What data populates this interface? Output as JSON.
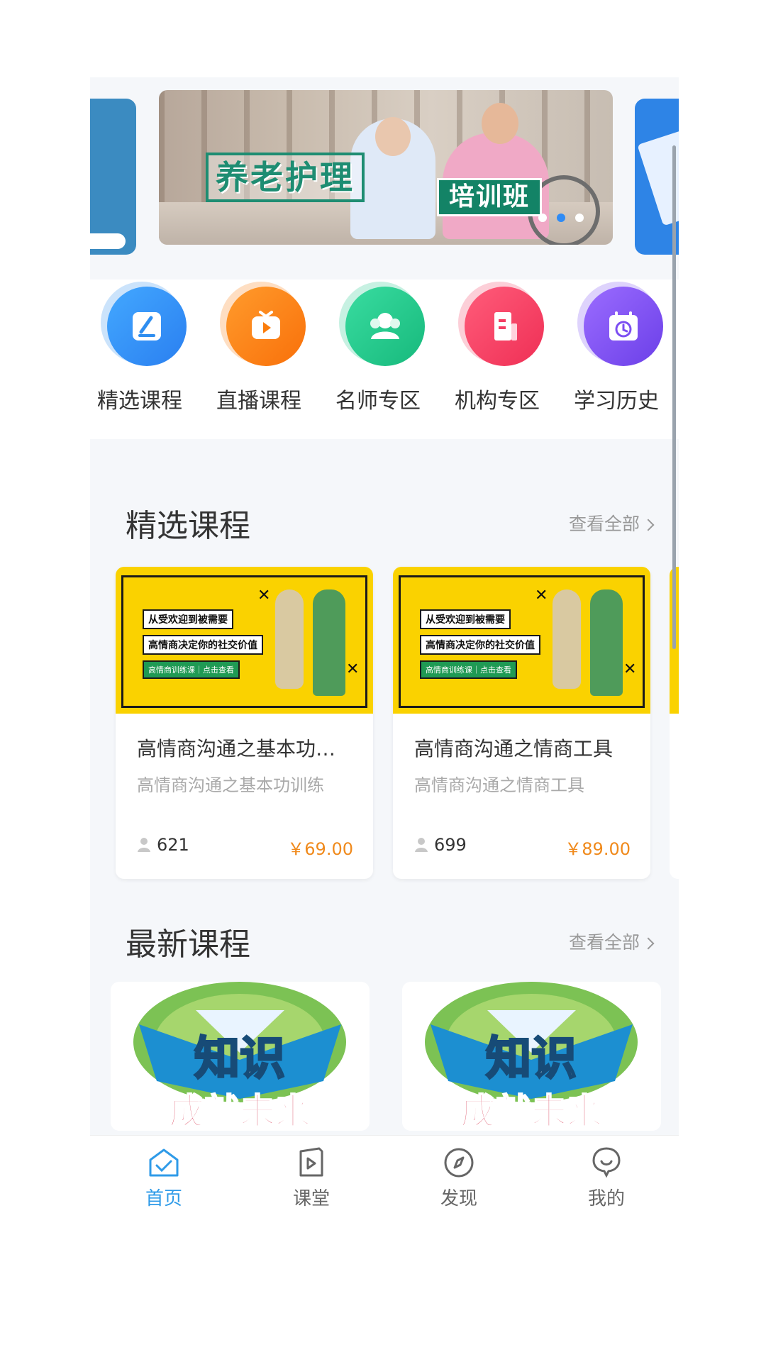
{
  "banner": {
    "title": "养老护理",
    "subtitle": "培训班",
    "dot_count": 3,
    "active_dot": 1
  },
  "menu": [
    {
      "label": "精选课程",
      "icon": "edit-book-icon",
      "color": "#2f8ef0"
    },
    {
      "label": "直播课程",
      "icon": "tv-play-icon",
      "color": "#fb7d0c"
    },
    {
      "label": "名师专区",
      "icon": "teacher-icon",
      "color": "#1fc78c"
    },
    {
      "label": "机构专区",
      "icon": "building-icon",
      "color": "#f43e62"
    },
    {
      "label": "学习历史",
      "icon": "calendar-clock-icon",
      "color": "#7c4ef2"
    }
  ],
  "featured": {
    "title": "精选课程",
    "see_all": "查看全部",
    "courses": [
      {
        "title": "高情商沟通之基本功…",
        "subtitle": "高情商沟通之基本功训练",
        "students": "621",
        "price": "￥69.00",
        "poster": {
          "line1": "从受欢迎到被需要",
          "line2": "高情商决定你的社交价值",
          "line3": "高情商训练课｜点击查看"
        }
      },
      {
        "title": "高情商沟通之情商工具",
        "subtitle": "高情商沟通之情商工具",
        "students": "699",
        "price": "￥89.00",
        "poster": {
          "line1": "从受欢迎到被需要",
          "line2": "高情商决定你的社交价值",
          "line3": "高情商训练课｜点击查看"
        }
      }
    ]
  },
  "latest": {
    "title": "最新课程",
    "see_all": "查看全部",
    "poster": {
      "top": "知识",
      "bottom": "成就未来"
    }
  },
  "tabbar": [
    {
      "label": "首页",
      "icon": "home-icon",
      "active": true
    },
    {
      "label": "课堂",
      "icon": "classroom-play-icon",
      "active": false
    },
    {
      "label": "发现",
      "icon": "compass-icon",
      "active": false
    },
    {
      "label": "我的",
      "icon": "profile-icon",
      "active": false
    }
  ],
  "colors": {
    "accent": "#2f9be8",
    "price": "#f08a1c",
    "poster_yellow": "#fad200"
  }
}
